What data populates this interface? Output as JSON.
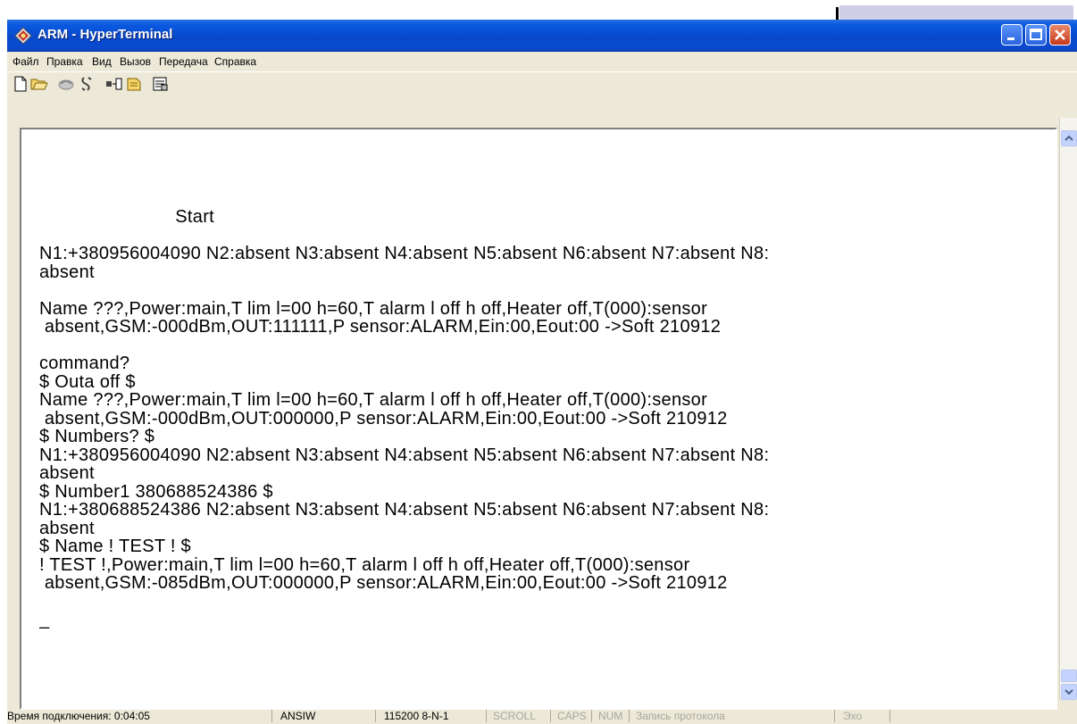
{
  "window": {
    "title": "ARM - HyperTerminal",
    "titlebar_color": "#0a58e0"
  },
  "menu": {
    "items": [
      "Файл",
      "Правка",
      "Вид",
      "Вызов",
      "Передача",
      "Справка"
    ]
  },
  "toolbar": {
    "icons": [
      "new-file-icon",
      "open-folder-icon",
      "connect-icon",
      "disconnect-icon",
      "send-icon",
      "receive-icon",
      "properties-icon"
    ]
  },
  "terminal": {
    "lines": [
      "",
      "",
      "",
      "",
      "                          Start",
      "",
      "N1:+380956004090 N2:absent N3:absent N4:absent N5:absent N6:absent N7:absent N8:",
      "absent",
      "",
      "Name ???,Power:main,T lim l=00 h=60,T alarm l off h off,Heater off,T(000):sensor",
      " absent,GSM:-000dBm,OUT:111111,P sensor:ALARM,Ein:00,Eout:00 ->Soft 210912",
      "",
      "command?",
      "$ Outa off $",
      "Name ???,Power:main,T lim l=00 h=60,T alarm l off h off,Heater off,T(000):sensor",
      " absent,GSM:-000dBm,OUT:000000,P sensor:ALARM,Ein:00,Eout:00 ->Soft 210912",
      "$ Numbers? $",
      "N1:+380956004090 N2:absent N3:absent N4:absent N5:absent N6:absent N7:absent N8:",
      "absent",
      "$ Number1 380688524386 $",
      "N1:+380688524386 N2:absent N3:absent N4:absent N5:absent N6:absent N7:absent N8:",
      "absent",
      "$ Name ! TEST ! $",
      "! TEST !,Power:main,T lim l=00 h=60,T alarm l off h off,Heater off,T(000):sensor",
      " absent,GSM:-085dBm,OUT:000000,P sensor:ALARM,Ein:00,Eout:00 ->Soft 210912",
      "",
      "_"
    ]
  },
  "status": {
    "connect_time": "Время подключения: 0:04:05",
    "emulation": "ANSIW",
    "port_settings": "115200 8-N-1",
    "scroll": "SCROLL",
    "caps": "CAPS",
    "num": "NUM",
    "capture": "Запись протокола",
    "echo": "Эхо"
  }
}
